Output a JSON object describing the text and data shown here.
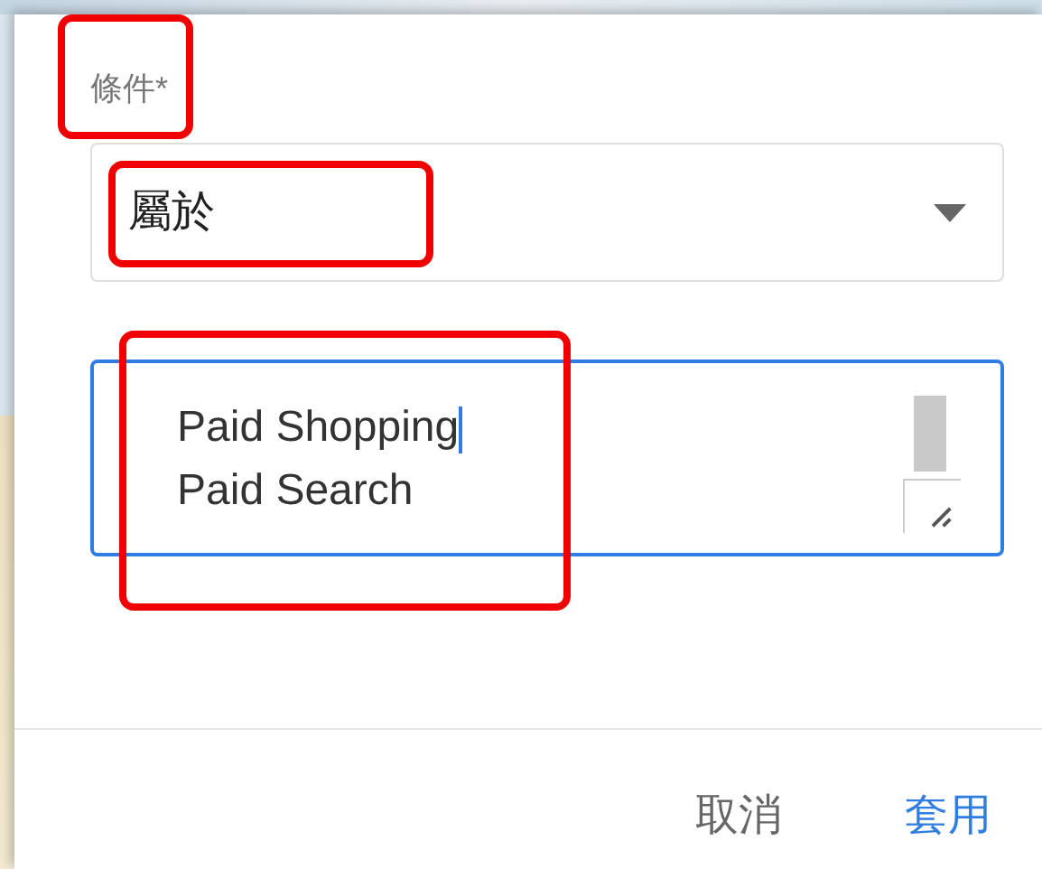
{
  "condition": {
    "label": "條件*",
    "highlighted": true
  },
  "operator": {
    "value": "屬於",
    "highlighted": true
  },
  "values": {
    "lines": [
      "Paid Shopping",
      "Paid Search"
    ],
    "focused": true,
    "highlighted": true
  },
  "buttons": [
    {
      "label": "取消",
      "kind": "secondary"
    },
    {
      "label": "套用",
      "kind": "primary"
    }
  ]
}
